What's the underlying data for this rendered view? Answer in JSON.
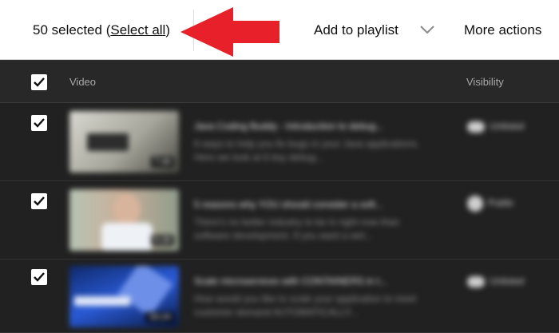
{
  "toolbar": {
    "selected_count": "50 selected",
    "open_paren": "(",
    "select_all": "Select all",
    "close_paren": ")",
    "add_to_playlist": "Add to playlist",
    "more_actions": "More actions"
  },
  "header": {
    "video": "Video",
    "visibility": "Visibility"
  },
  "rows": [
    {
      "title": "Java Coding Buddy - Introduction to debug...",
      "desc": "6 ways to help you fix bugs in your Java applications. Here we look at 6 key debug...",
      "duration": "7:49",
      "visibility": "Unlisted"
    },
    {
      "title": "5 reasons why YOU should consider a soft...",
      "desc": "There's no better industry to be in right now than software development. If you want a wel...",
      "duration": "5:28",
      "visibility": "Public"
    },
    {
      "title": "Scale microservices with CONTAINERS in t...",
      "desc": "How would you like to scale your application to meet customer demand AUTOMATICALLY...",
      "duration": "16:24",
      "visibility": "Unlisted"
    }
  ],
  "colors": {
    "arrow": "#e8202a",
    "background": "#282828",
    "toolbar": "#ffffff"
  }
}
